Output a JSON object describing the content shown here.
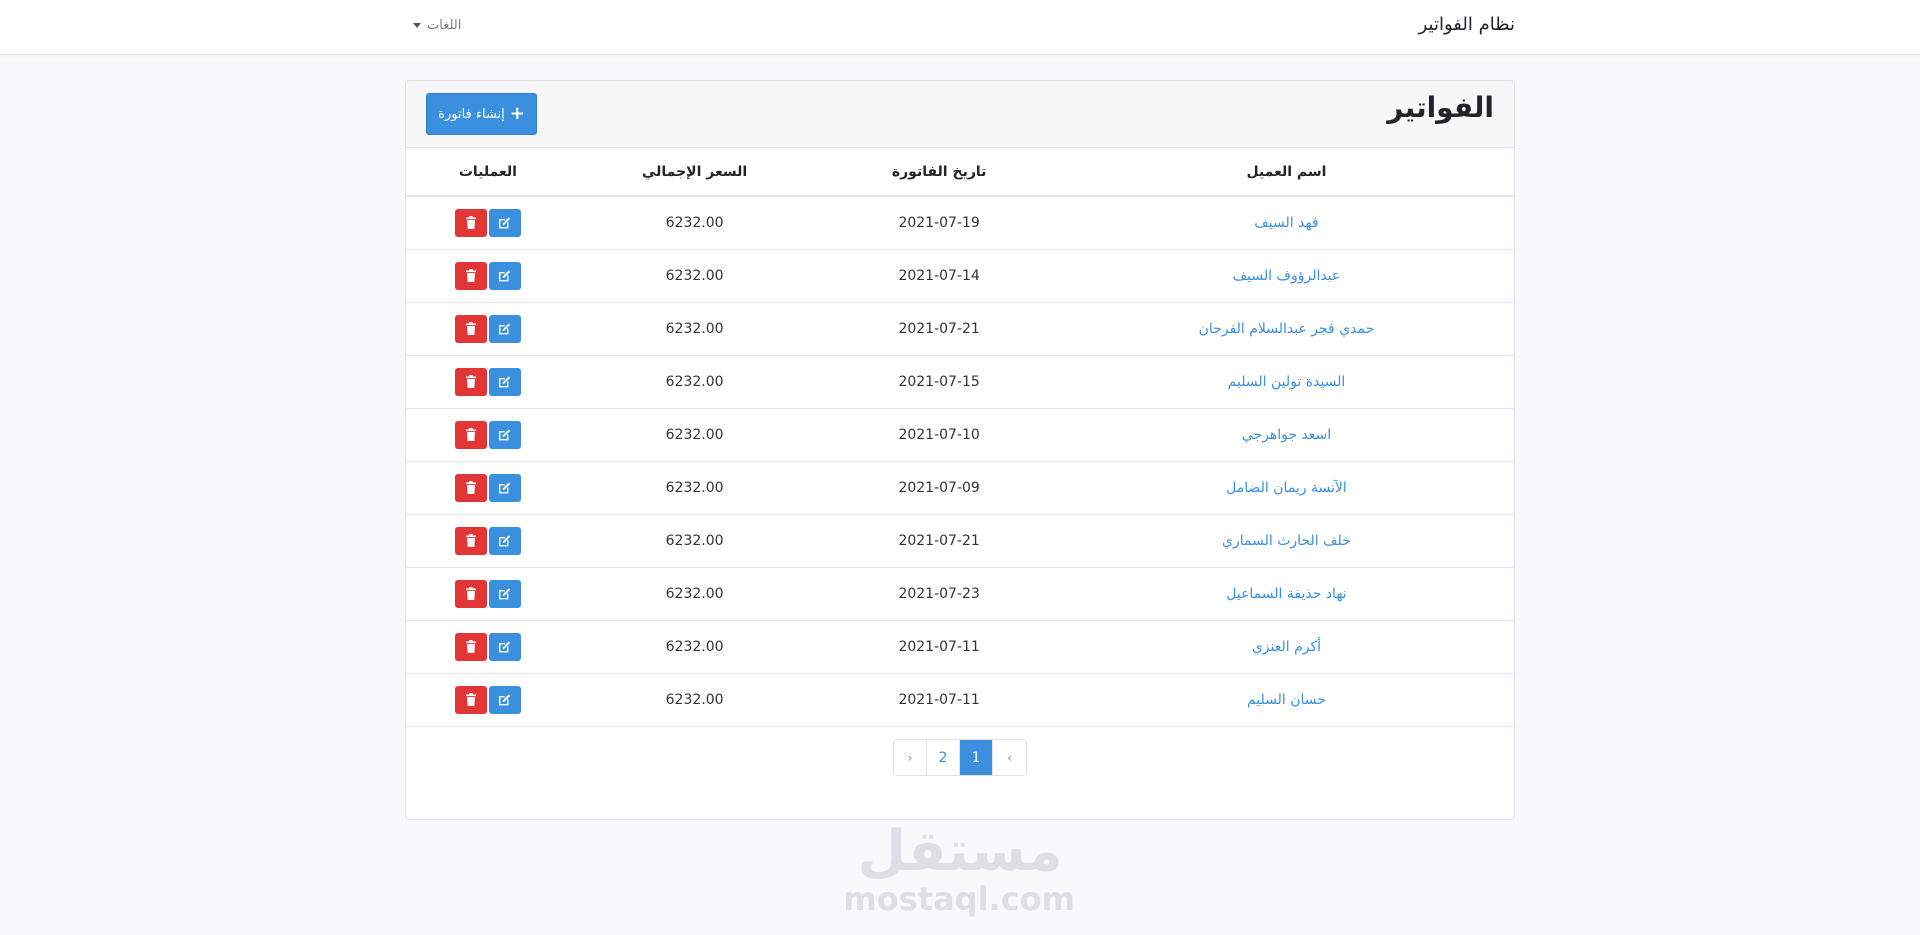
{
  "navbar": {
    "brand": "نظام الفواتير",
    "languages_label": "اللغات"
  },
  "card": {
    "title": "الفواتير",
    "create_button_label": "إنشاء فاتورة"
  },
  "table": {
    "headers": {
      "client_name": "اسم العميل",
      "invoice_date": "تاريخ الفاتورة",
      "total_price": "السعر الإجمالي",
      "actions": "العمليات"
    },
    "rows": [
      {
        "client_name": "فهد السيف",
        "invoice_date": "2021-07-19",
        "total_price": "6232.00"
      },
      {
        "client_name": "عبدالرؤوف السيف",
        "invoice_date": "2021-07-14",
        "total_price": "6232.00"
      },
      {
        "client_name": "حمدي فجر عبدالسلام الفرحان",
        "invoice_date": "2021-07-21",
        "total_price": "6232.00"
      },
      {
        "client_name": "السيدة تولين السليم",
        "invoice_date": "2021-07-15",
        "total_price": "6232.00"
      },
      {
        "client_name": "اسعد جواهرجي",
        "invoice_date": "2021-07-10",
        "total_price": "6232.00"
      },
      {
        "client_name": "الآنسة ريمان الضامل",
        "invoice_date": "2021-07-09",
        "total_price": "6232.00"
      },
      {
        "client_name": "خلف الحارث السماري",
        "invoice_date": "2021-07-21",
        "total_price": "6232.00"
      },
      {
        "client_name": "نهاد حذيفة السماعيل",
        "invoice_date": "2021-07-23",
        "total_price": "6232.00"
      },
      {
        "client_name": "أكرم العنزي",
        "invoice_date": "2021-07-11",
        "total_price": "6232.00"
      },
      {
        "client_name": "حسان السليم",
        "invoice_date": "2021-07-11",
        "total_price": "6232.00"
      }
    ]
  },
  "pagination": {
    "prev": "‹",
    "pages": [
      "1",
      "2"
    ],
    "current": "1",
    "next": "›"
  },
  "watermark": {
    "logo": "مستقل",
    "domain": "mostaql.com"
  },
  "colors": {
    "primary": "#3a8fde",
    "danger": "#e23636",
    "background": "#f8f9fb"
  }
}
